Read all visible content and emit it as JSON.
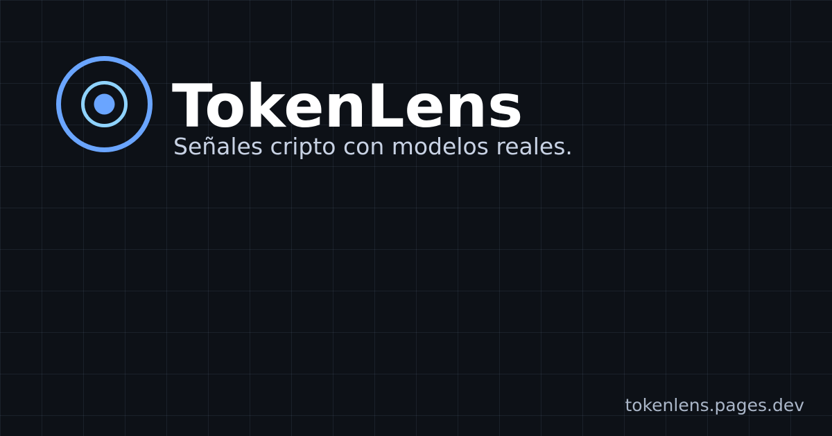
{
  "brand": {
    "name": "TokenLens",
    "tagline": "Señales cripto con modelos reales.",
    "url": "tokenlens.pages.dev",
    "logo_icon": "concentric-target-icon"
  },
  "colors": {
    "background": "#0d1117",
    "grid": "#1f2633",
    "logo_outer_ring": "#6aa5ff",
    "logo_inner_ring": "#8fd3ff",
    "logo_dot": "#6aa5ff",
    "title": "#ffffff",
    "tagline": "#c8d2e4",
    "url": "#aab6c8"
  }
}
